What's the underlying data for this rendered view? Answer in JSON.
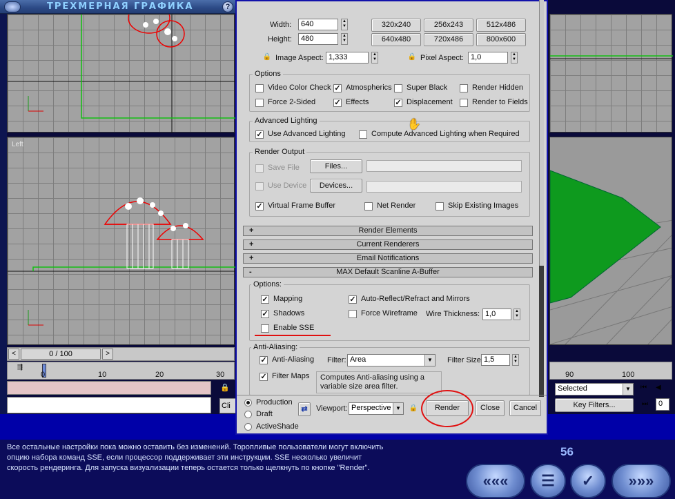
{
  "app": {
    "title": "ТРЕХМЕРНАЯ ГРАФИКА"
  },
  "viewports": {
    "left_label": "Left"
  },
  "timeline": {
    "frame": "0 / 100",
    "ticks_left": [
      "0",
      "10",
      "20",
      "30"
    ],
    "ticks_right": [
      "90",
      "100"
    ],
    "selected_value": "Selected",
    "key_filters": "Key Filters...",
    "frame_field": "0",
    "cli_text": "Cli"
  },
  "output_size": {
    "width_label": "Width:",
    "width_value": "640",
    "height_label": "Height:",
    "height_value": "480",
    "presets": [
      "320x240",
      "256x243",
      "512x486",
      "640x480",
      "720x486",
      "800x600"
    ],
    "image_aspect_label": "Image Aspect:",
    "image_aspect_value": "1,333",
    "pixel_aspect_label": "Pixel Aspect:",
    "pixel_aspect_value": "1,0"
  },
  "options": {
    "title": "Options",
    "video_color_check": "Video Color Check",
    "atmospherics": "Atmospherics",
    "super_black": "Super Black",
    "render_hidden": "Render Hidden",
    "force_2_sided": "Force 2-Sided",
    "effects": "Effects",
    "displacement": "Displacement",
    "render_to_fields": "Render to Fields"
  },
  "advanced_lighting": {
    "title": "Advanced Lighting",
    "use": "Use Advanced Lighting",
    "compute": "Compute Advanced Lighting when Required"
  },
  "render_output": {
    "title": "Render Output",
    "save_file": "Save File",
    "files_button": "Files...",
    "use_device": "Use Device",
    "devices_button": "Devices...",
    "virtual_frame_buffer": "Virtual Frame Buffer",
    "net_render": "Net Render",
    "skip_existing": "Skip Existing Images"
  },
  "rollouts": {
    "render_elements": "Render Elements",
    "current_renderers": "Current Renderers",
    "email_notifications": "Email Notifications",
    "scanline": "MAX Default Scanline A-Buffer",
    "plus": "+",
    "minus": "-"
  },
  "scanline_options": {
    "title": "Options:",
    "mapping": "Mapping",
    "auto_reflect": "Auto-Reflect/Refract and Mirrors",
    "shadows": "Shadows",
    "force_wireframe": "Force Wireframe",
    "wire_thickness_label": "Wire Thickness:",
    "wire_thickness_value": "1,0",
    "enable_sse": "Enable SSE"
  },
  "anti_aliasing": {
    "title": "Anti-Aliasing:",
    "aa": "Anti-Aliasing",
    "filter_label": "Filter:",
    "filter_value": "Area",
    "filter_size_label": "Filter Size:",
    "filter_size_value": "1,5",
    "filter_maps": "Filter Maps",
    "description": "Computes Anti-aliasing using a variable size area filter."
  },
  "footer": {
    "production": "Production",
    "draft": "Draft",
    "activeshade": "ActiveShade",
    "viewport_label": "Viewport:",
    "viewport_value": "Perspective",
    "render": "Render",
    "close": "Close",
    "cancel": "Cancel"
  },
  "instructions": {
    "text": "Все остальные настройки пока можно оставить без изменений. Торопливые пользователи могут включить\nопцию набора команд SSE, если процессор поддерживает эти инструкции. SSE несколько увеличит\nскорость рендеринга. Для запуска визуализации теперь остается только щелкнуть по кнопке \"Render\".",
    "page_number": "56"
  },
  "nav": {
    "back_all": "«««",
    "menu": "☰",
    "check": "✓",
    "forward_all": "»»»"
  },
  "colors": {
    "highlight_red": "#e01010",
    "dialog_border": "#1212aa",
    "ground_green": "#0e9a1e"
  }
}
